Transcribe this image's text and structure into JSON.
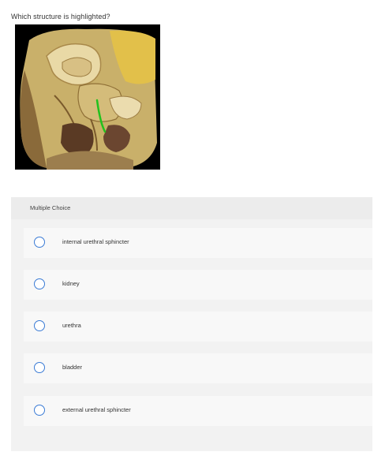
{
  "question": {
    "text": "Which structure is highlighted?"
  },
  "specimen": {
    "description_icon": "anatomical-sagittal-section-image",
    "highlight_color": "#22c11e"
  },
  "panel": {
    "title": "Multiple Choice",
    "choices": [
      {
        "label": "internal urethral sphincter"
      },
      {
        "label": "kidney"
      },
      {
        "label": "urethra"
      },
      {
        "label": "bladder"
      },
      {
        "label": "external urethral sphincter"
      }
    ]
  },
  "colors": {
    "radio_border": "#3a7bd5",
    "panel_bg": "#f2f2f2",
    "choice_bg": "#f8f8f8"
  }
}
